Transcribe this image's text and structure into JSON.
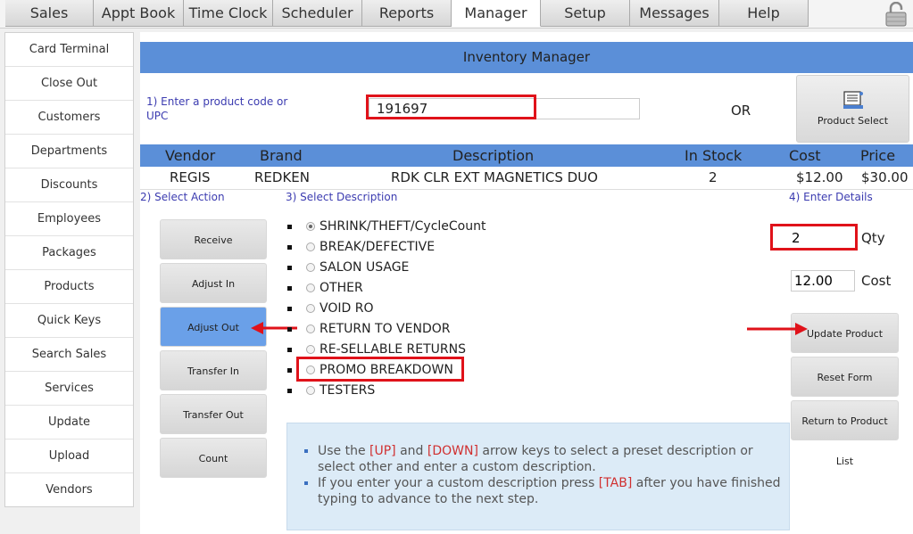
{
  "nav": {
    "tabs": [
      "Sales",
      "Appt Book",
      "Time Clock",
      "Scheduler",
      "Reports",
      "Manager",
      "Setup",
      "Messages",
      "Help"
    ],
    "active_tab": "Manager"
  },
  "sidebar": {
    "items": [
      "Card Terminal",
      "Close Out",
      "Customers",
      "Departments",
      "Discounts",
      "Employees",
      "Packages",
      "Products",
      "Quick Keys",
      "Search Sales",
      "Services",
      "Update",
      "Upload",
      "Vendors"
    ]
  },
  "page": {
    "title": "Inventory Manager"
  },
  "step1": {
    "label": "1) Enter a product code or UPC",
    "code_value": "191697",
    "or_text": "OR",
    "product_select_label": "Product Select"
  },
  "table": {
    "headers": {
      "vendor": "Vendor",
      "brand": "Brand",
      "description": "Description",
      "in_stock": "In Stock",
      "cost": "Cost",
      "price": "Price"
    },
    "row": {
      "vendor": "REGIS",
      "brand": "REDKEN",
      "description": "RDK CLR EXT MAGNETICS DUO",
      "in_stock": "2",
      "cost": "$12.00",
      "price": "$30.00"
    }
  },
  "step2": {
    "label": "2) Select Action",
    "actions": [
      "Receive",
      "Adjust In",
      "Adjust Out",
      "Transfer In",
      "Transfer Out",
      "Count"
    ],
    "active_action": "Adjust Out"
  },
  "step3": {
    "label": "3) Select Description",
    "options": [
      "SHRINK/THEFT/CycleCount",
      "BREAK/DEFECTIVE",
      "SALON USAGE",
      "OTHER",
      "VOID RO",
      "RETURN TO VENDOR",
      "RE-SELLABLE RETURNS",
      "PROMO BREAKDOWN",
      "TESTERS"
    ],
    "selected_option": "SHRINK/THEFT/CycleCount"
  },
  "step4": {
    "label": "4) Enter Details",
    "qty_value": "2",
    "qty_label": "Qty",
    "cost_value": "12.00",
    "cost_label": "Cost",
    "update_label": "Update Product",
    "reset_label": "Reset Form",
    "return_label": "Return to Product List"
  },
  "help": {
    "line1_pre": "Use the ",
    "key_up": "[UP]",
    "line1_mid": " and ",
    "key_down": "[DOWN]",
    "line1_post": " arrow keys to select a preset description or select other and enter a custom description.",
    "line2_pre": "If you enter your a custom description press ",
    "key_tab": "[TAB]",
    "line2_post": " after you have finished typing to advance to the next step."
  },
  "colors": {
    "accent": "#5b8fd8",
    "highlight": "#e0121a",
    "active_button": "#6aa0e8",
    "step_label": "#3b3bb0"
  }
}
